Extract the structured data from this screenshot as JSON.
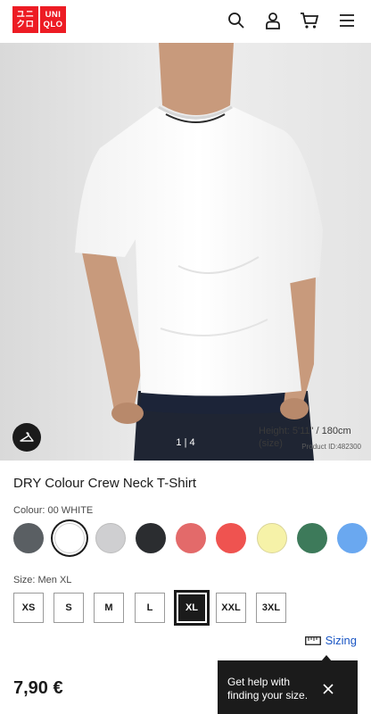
{
  "header": {
    "logo_top": "ユニ",
    "logo_bottom": "クロ",
    "logo_top_latin": "UNI",
    "logo_bottom_latin": "QLO",
    "icons": [
      "search-icon",
      "user-icon",
      "cart-icon",
      "menu-icon"
    ]
  },
  "hero": {
    "pager": "1 | 4",
    "product_id": "Product ID:482300",
    "height_line1": "Height: 5'11\" / 180cm",
    "height_line2": "(size)"
  },
  "product": {
    "title": "DRY Colour Crew Neck T-Shirt",
    "colour_label": "Colour: 00 WHITE",
    "swatches": [
      {
        "name": "dark grey",
        "color": "#5a5f63"
      },
      {
        "name": "white",
        "color": "#ffffff",
        "selected": true
      },
      {
        "name": "light grey",
        "color": "#cfcfd1"
      },
      {
        "name": "black",
        "color": "#2b2d30"
      },
      {
        "name": "coral",
        "color": "#e36a6a"
      },
      {
        "name": "red",
        "color": "#ef5350"
      },
      {
        "name": "light yellow",
        "color": "#f6f2a8"
      },
      {
        "name": "green",
        "color": "#3d7a5a"
      },
      {
        "name": "blue",
        "color": "#6aa8f0"
      }
    ],
    "size_label": "Size: Men XL",
    "sizes": [
      "XS",
      "S",
      "M",
      "L",
      "XL",
      "XXL",
      "3XL"
    ],
    "selected_size": "XL",
    "sizing_link": "Sizing",
    "price": "7,90 €"
  },
  "tooltip": {
    "line1": "Get help with",
    "line2": "finding your size."
  }
}
